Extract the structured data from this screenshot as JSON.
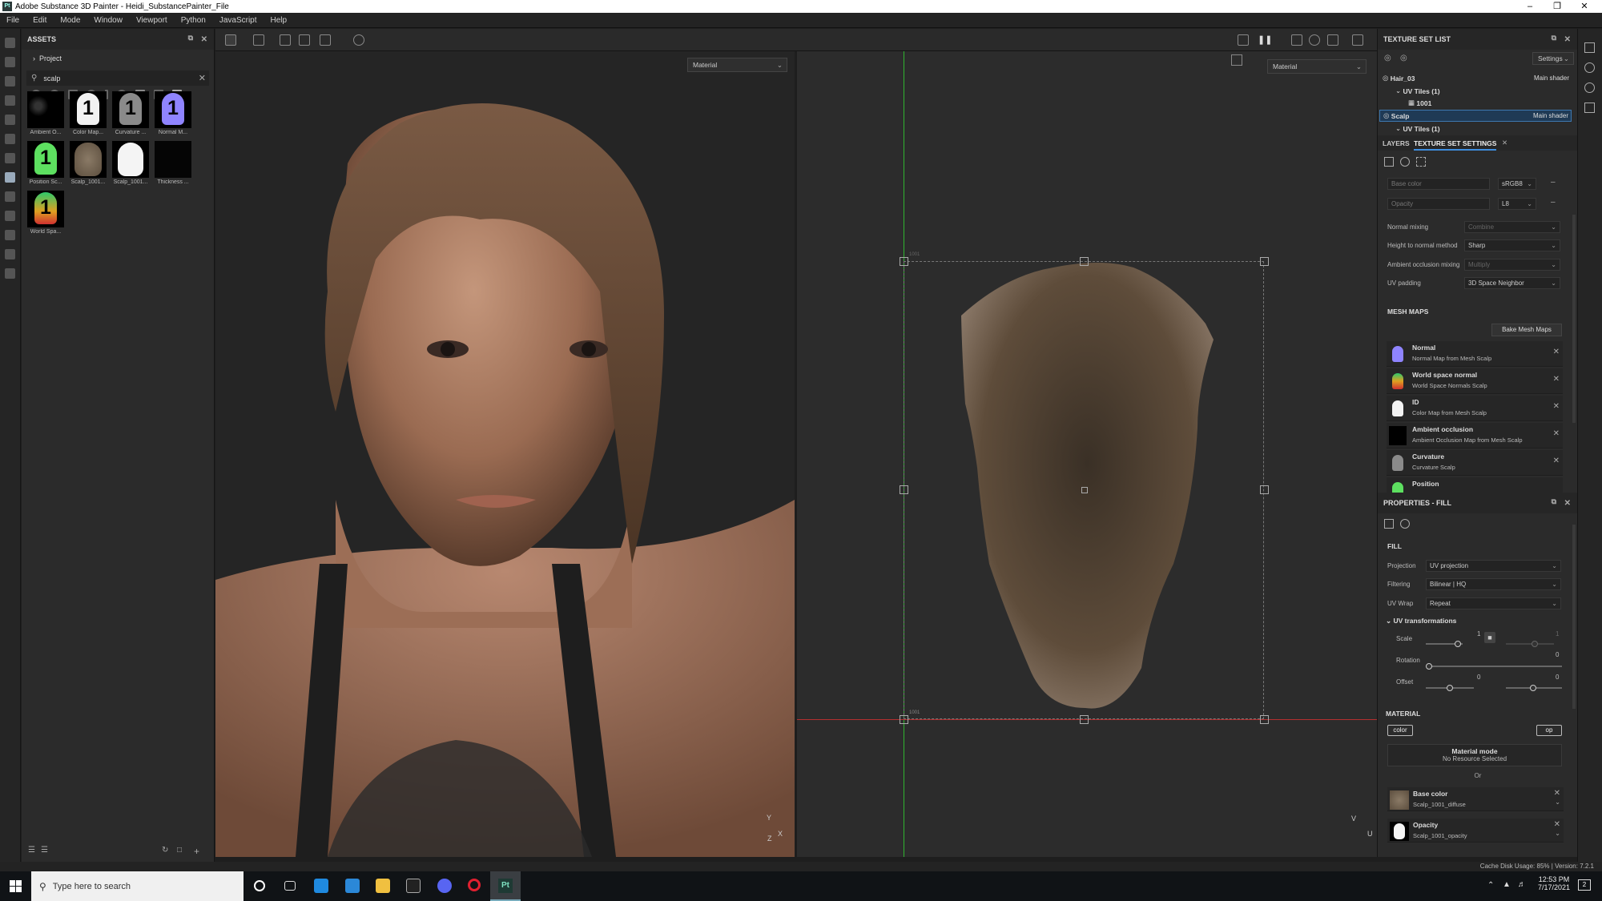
{
  "window": {
    "title": "Adobe Substance 3D Painter - Heidi_SubstancePainter_File",
    "logo": "Pt"
  },
  "menu": [
    "File",
    "Edit",
    "Mode",
    "Window",
    "Viewport",
    "Python",
    "JavaScript",
    "Help"
  ],
  "assets": {
    "title": "ASSETS",
    "project_label": "Project",
    "search_value": "scalp",
    "items": [
      {
        "label": "Ambient O...",
        "badge": ""
      },
      {
        "label": "Color Map...",
        "badge": "1"
      },
      {
        "label": "Curvature ...",
        "badge": "1"
      },
      {
        "label": "Normal M...",
        "badge": "1"
      },
      {
        "label": "Position Sc...",
        "badge": "1"
      },
      {
        "label": "Scalp_1001...",
        "badge": ""
      },
      {
        "label": "Scalp_1001...",
        "badge": ""
      },
      {
        "label": "Thickness ...",
        "badge": ""
      },
      {
        "label": "World Spa...",
        "badge": "1"
      }
    ]
  },
  "viewport3d": {
    "material_select": "Material",
    "axis_y": "Y",
    "axis_x": "X",
    "axis_z": "Z"
  },
  "viewport2d": {
    "material_select": "Material",
    "tile_label_top": "1001",
    "tile_label_bottom": "1001",
    "axis_v": "V",
    "axis_u": "U"
  },
  "texture_set_list": {
    "title": "TEXTURE SET LIST",
    "settings_label": "Settings",
    "rows": [
      {
        "name": "Hair_03",
        "shader": "Main shader"
      },
      {
        "name": "UV Tiles (1)"
      },
      {
        "name": "1001"
      },
      {
        "name": "Scalp",
        "shader": "Main shader"
      },
      {
        "name": "UV Tiles (1)"
      }
    ]
  },
  "tabs": {
    "layers": "LAYERS",
    "tss": "TEXTURE SET SETTINGS"
  },
  "tss": {
    "channels": [
      {
        "name": "Base color",
        "format": "sRGB8"
      },
      {
        "name": "Opacity",
        "format": "L8"
      }
    ],
    "settings": [
      {
        "label": "Normal mixing",
        "value": "Combine"
      },
      {
        "label": "Height to normal method",
        "value": "Sharp"
      },
      {
        "label": "Ambient occlusion mixing",
        "value": "Multiply"
      },
      {
        "label": "UV padding",
        "value": "3D Space Neighbor"
      }
    ],
    "mesh_maps_title": "MESH MAPS",
    "bake_button": "Bake Mesh Maps",
    "mesh_maps": [
      {
        "name": "Normal",
        "desc": "Normal Map from Mesh Scalp"
      },
      {
        "name": "World space normal",
        "desc": "World Space Normals Scalp"
      },
      {
        "name": "ID",
        "desc": "Color Map from Mesh Scalp"
      },
      {
        "name": "Ambient occlusion",
        "desc": "Ambient Occlusion Map from Mesh Scalp"
      },
      {
        "name": "Curvature",
        "desc": "Curvature Scalp"
      },
      {
        "name": "Position",
        "desc": ""
      }
    ]
  },
  "properties": {
    "title": "PROPERTIES - FILL",
    "fill_title": "FILL",
    "projection_label": "Projection",
    "projection_value": "UV projection",
    "filtering_label": "Filtering",
    "filtering_value": "Bilinear | HQ",
    "uvwrap_label": "UV Wrap",
    "uvwrap_value": "Repeat",
    "uvt_title": "UV transformations",
    "scale_label": "Scale",
    "scale_value": "1",
    "scale_value2": "1",
    "rotation_label": "Rotation",
    "rotation_value": "0",
    "offset_label": "Offset",
    "offset_value1": "0",
    "offset_value2": "0",
    "material_title": "MATERIAL",
    "color_btn": "color",
    "op_btn": "op",
    "material_mode": "Material mode",
    "no_resource": "No Resource Selected",
    "or": "Or",
    "channels": [
      {
        "name": "Base color",
        "file": "Scalp_1001_diffuse"
      },
      {
        "name": "Opacity",
        "file": "Scalp_1001_opacity"
      }
    ]
  },
  "status": {
    "cache": "Cache Disk Usage:",
    "cache_value": "85%",
    "version": "| Version: 7.2.1"
  },
  "taskbar": {
    "search_placeholder": "Type here to search",
    "time": "12:53 PM",
    "date": "7/17/2021",
    "notif": "2"
  }
}
